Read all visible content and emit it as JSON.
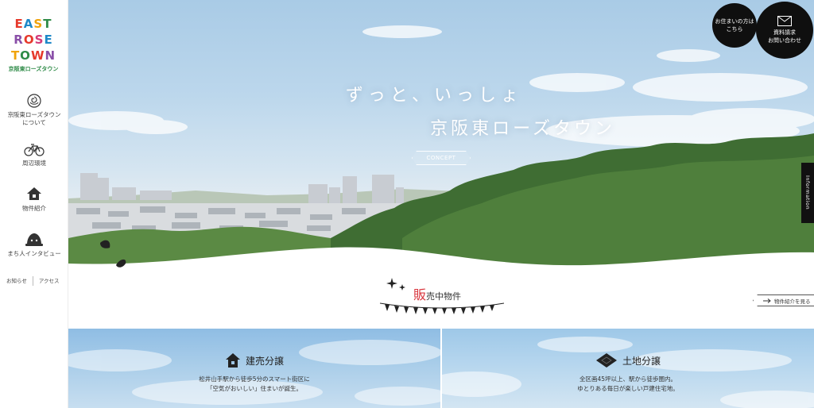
{
  "logo": {
    "line1": [
      "E",
      "A",
      "S",
      "T"
    ],
    "line2": [
      "R",
      "O",
      "S",
      "E"
    ],
    "line3": [
      "T",
      "O",
      "W",
      "N"
    ],
    "sub": "京阪東ローズタウン"
  },
  "sidebar": {
    "items": [
      {
        "icon": "rose-icon",
        "label_1": "京阪東ローズタウン",
        "label_2": "について"
      },
      {
        "icon": "bicycle-icon",
        "label_1": "周辺環境"
      },
      {
        "icon": "house-icon",
        "label_1": "物件紹介"
      },
      {
        "icon": "interview-icon",
        "label_1": "まち人インタビュー"
      }
    ],
    "sub_links": [
      "お知らせ",
      "アクセス"
    ]
  },
  "hero": {
    "line1": "ずっと、いっしょ",
    "line2": "京阪東ローズタウン",
    "concept_label": "CONCEPT"
  },
  "header_buttons": {
    "residents": {
      "line1": "お住まいの方は",
      "line2": "こちら"
    },
    "contact": {
      "icon": "mail-icon",
      "line1": "資料請求",
      "line2": "お問い合わせ"
    }
  },
  "info_tab": "Information",
  "sale": {
    "title_first": "販",
    "title_rest": "売中物件",
    "property_link": "物件紹介を見る"
  },
  "cards": {
    "left": {
      "icon": "house-icon",
      "title": "建売分譲",
      "text_1": "松井山手駅から徒歩5分のスマート街区に",
      "text_2": "「空気がおいしい」住まいが誕生。"
    },
    "right": {
      "icon": "land-icon",
      "title": "土地分譲",
      "text_1": "全区画45坪以上、駅から徒歩圏内。",
      "text_2": "ゆとりある毎日が楽しい戸建住宅地。"
    }
  },
  "colors": {
    "accent_red": "#d9363e",
    "logo_green": "#2f8b48",
    "button_black": "#0f0f0f"
  }
}
